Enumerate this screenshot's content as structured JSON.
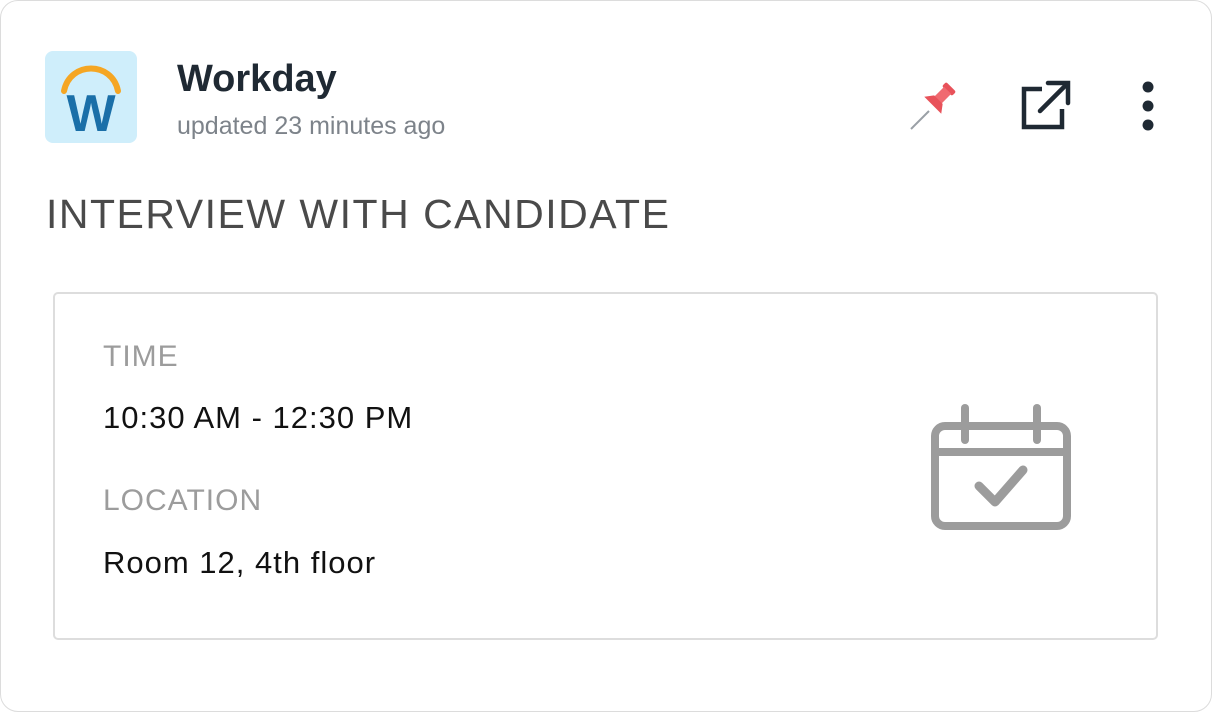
{
  "app": {
    "name": "Workday",
    "updated": "updated 23 minutes ago",
    "logo_letter": "W"
  },
  "actions": {
    "pin_icon": "pushpin-icon",
    "external_icon": "external-link-icon",
    "more_icon": "more-vertical-icon"
  },
  "event": {
    "title": "INTERVIEW WITH CANDIDATE",
    "time_label": "TIME",
    "time_value": "10:30 AM - 12:30 PM",
    "location_label": "LOCATION",
    "location_value": "Room 12, 4th floor",
    "icon": "calendar-check-icon"
  },
  "colors": {
    "logo_bg": "#cfeefb",
    "logo_arc": "#f5a623",
    "logo_letter": "#1a6fa8",
    "pin": "#e8525a",
    "icon_dark": "#1f2933",
    "calendar": "#9c9c9c"
  }
}
